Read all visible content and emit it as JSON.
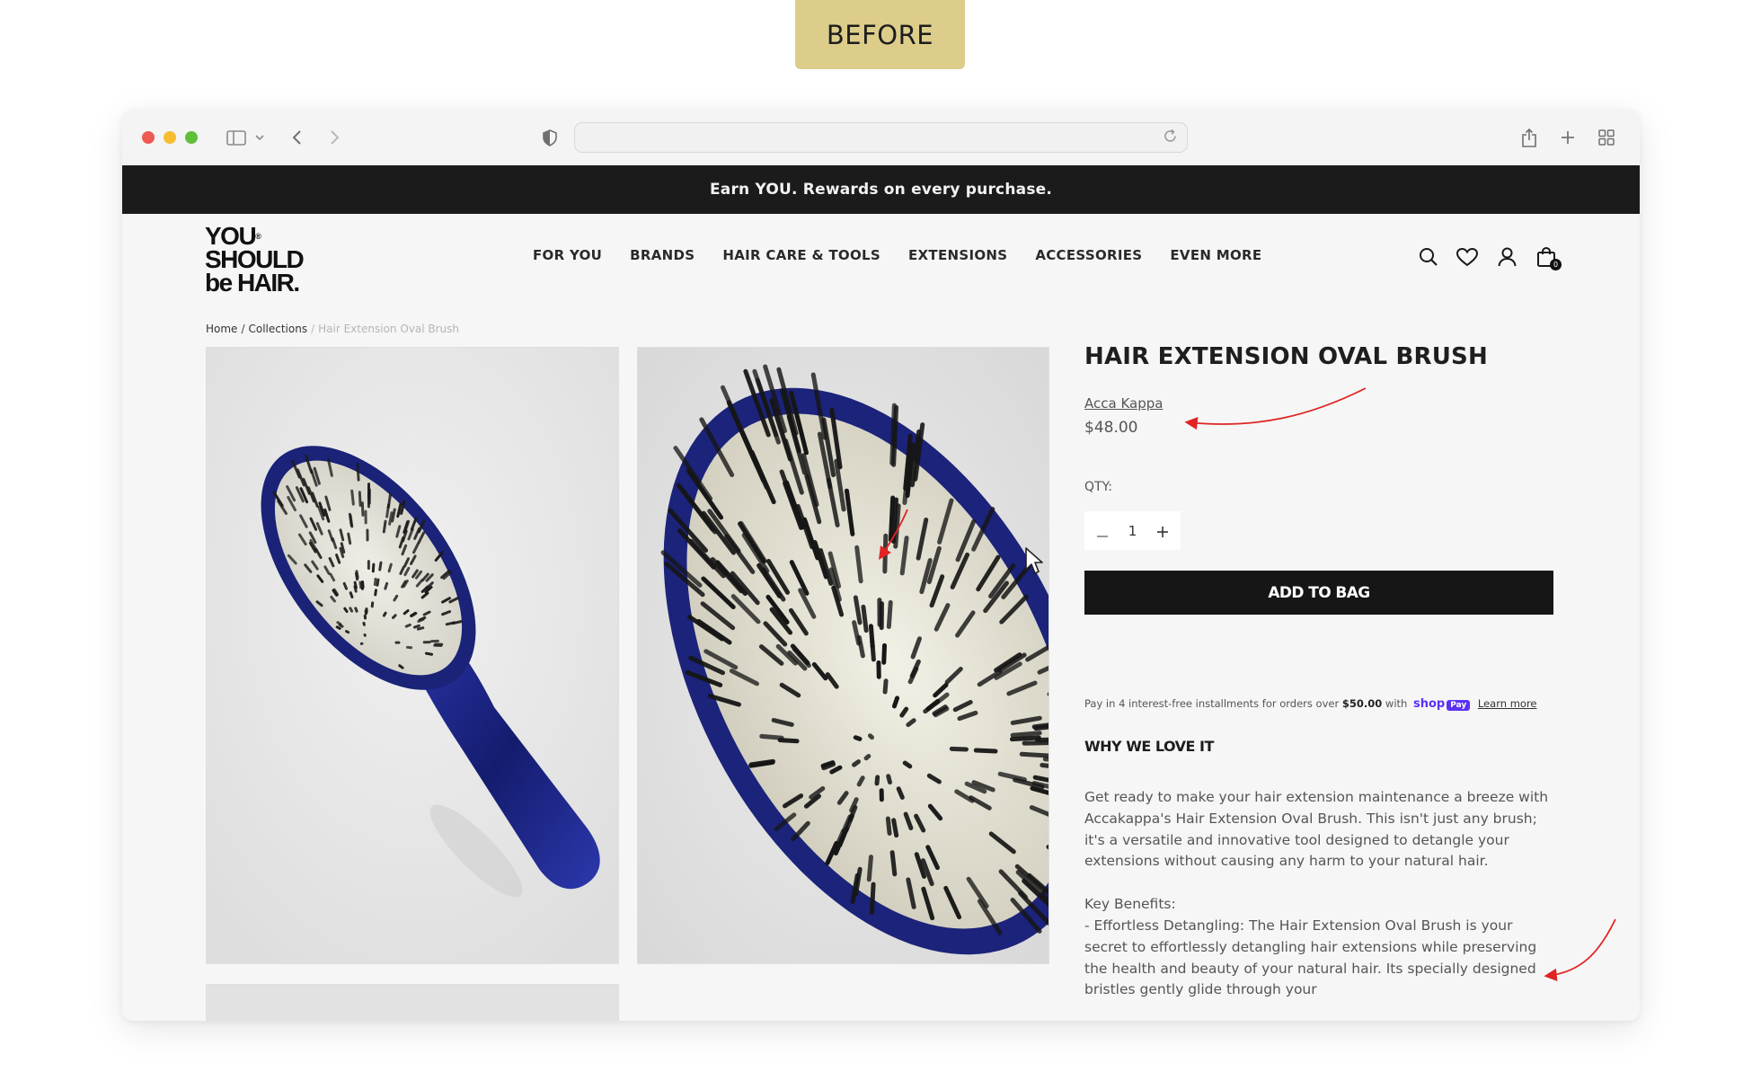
{
  "badge": {
    "label": "BEFORE"
  },
  "promo": {
    "text": "Earn YOU. Rewards on every purchase."
  },
  "logo": {
    "line1": "YOU",
    "line2": "SHOULD",
    "line3": "be HAIR."
  },
  "nav": {
    "items": [
      {
        "label": "FOR YOU"
      },
      {
        "label": "BRANDS"
      },
      {
        "label": "HAIR CARE & TOOLS"
      },
      {
        "label": "EXTENSIONS"
      },
      {
        "label": "ACCESSORIES"
      },
      {
        "label": "EVEN MORE"
      }
    ]
  },
  "header_icons": {
    "cart_count": "0"
  },
  "breadcrumb": {
    "home": "Home",
    "collections": "Collections",
    "current": "Hair Extension Oval Brush"
  },
  "product": {
    "title": "HAIR EXTENSION OVAL BRUSH",
    "brand": "Acca Kappa",
    "price": "$48.00",
    "qty_label": "QTY:",
    "qty_value": "1",
    "add_to_bag": "ADD TO BAG",
    "installments_prefix": "Pay in 4 interest-free installments for orders over",
    "installments_amount": "$50.00",
    "installments_with": "with",
    "shop_pay": "shop",
    "shop_pay_badge": "Pay",
    "learn_more": "Learn more",
    "why_heading": "WHY WE LOVE IT",
    "description": "Get ready to make your hair extension maintenance a breeze with Accakappa's Hair Extension Oval Brush. This isn't just any brush; it's a versatile and innovative tool designed to detangle your extensions without causing any harm to your natural hair.",
    "benefits_heading": "Key Benefits:",
    "benefit_1": "- Effortless Detangling: The Hair Extension Oval Brush is your secret to effortlessly detangling hair extensions while preserving the health and beauty of your natural hair. Its specially designed bristles gently glide through your"
  },
  "colors": {
    "accent_badge": "#dccd8b",
    "annotation": "#e02424",
    "promo_bg": "#1b1b1b",
    "brush_handle": "#1f2a8c"
  }
}
